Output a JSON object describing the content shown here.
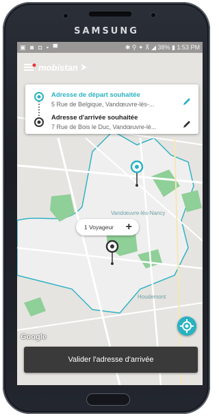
{
  "device": {
    "brand": "SAMSUNG"
  },
  "status_bar": {
    "left_icons": "▣ ◙ ◘ ▪ ▀",
    "right_text": "✱ ⚲ ✦ ⊼ ◢ 38% ▮ 1:53 PM"
  },
  "app": {
    "logo_text": "mobistan"
  },
  "route_card": {
    "departure": {
      "title": "Adresse de départ souhaitée",
      "address": "5 Rue de Belgique, Vandœuvre-lès-..."
    },
    "arrival": {
      "title": "Adresse d'arrivée souhaitée",
      "address": "7 Rue de Bois le Duc, Vandœuvre-lè..."
    }
  },
  "travelers": {
    "label": "1 Voyageur",
    "add_symbol": "+"
  },
  "map": {
    "labels": {
      "city": "Vandœuvre-lès-Nancy",
      "district": "Houdemont"
    },
    "attribution": "Google"
  },
  "validate_button": {
    "label": "Valider l'adresse d'arrivée"
  },
  "colors": {
    "accent": "#29b2c2",
    "dark": "#3a3a3a",
    "park": "#8fcf98",
    "map": "#e6e4e0"
  },
  "icons": [
    "pin-departure-icon",
    "pin-arrival-icon",
    "pencil-icon",
    "locate-icon",
    "menu-icon",
    "arrow-logo-icon"
  ]
}
